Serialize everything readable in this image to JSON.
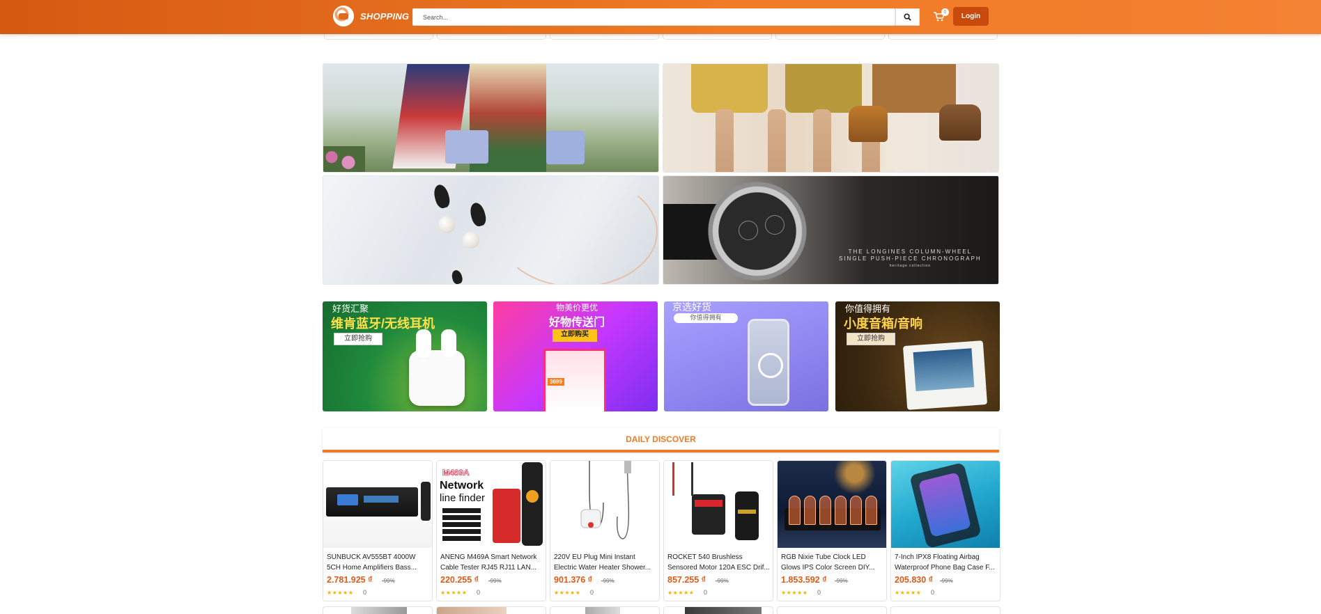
{
  "header": {
    "brand": "SHOPPING",
    "search_placeholder": "Search...",
    "cart_count": "0",
    "login_label": "Login",
    "accent_color": "#f07a25"
  },
  "banners": [
    {
      "name": "fashion-scarves-banner"
    },
    {
      "name": "leather-handbags-banner"
    },
    {
      "name": "swan-jewelry-banner"
    },
    {
      "name": "longines-watch-banner",
      "text_line1": "THE LONGINES COLUMN-WHEEL",
      "text_line2": "SINGLE PUSH-PIECE CHRONOGRAPH",
      "text_line3": "heritage collection"
    }
  ],
  "promos": [
    {
      "tag": "好货汇聚",
      "title": "维肯蓝牙/无线耳机",
      "button": "立即抢购"
    },
    {
      "tag": "物美价更优",
      "title": "好物传送门",
      "button": "立即购买",
      "price_tag": "3699"
    },
    {
      "tag": "京选好货",
      "title": "",
      "button": "你值得拥有"
    },
    {
      "tag": "你值得拥有",
      "title": "小度音箱/音响",
      "button": "立即抢购"
    }
  ],
  "discover_title": "DAILY DISCOVER",
  "products": [
    {
      "name_line1": "SUNBUCK AV555BT 4000W",
      "name_line2": "5CH Home Amplifiers Bass...",
      "price": "2.781.925 ₫",
      "discount": "-99%",
      "stars": "★★★★★",
      "sold": "0"
    },
    {
      "name_line1": "ANENG M469A Smart Network",
      "name_line2": "Cable Tester RJ45 RJ11 LAN...",
      "price": "220.255 ₫",
      "discount": "-99%",
      "stars": "★★★★★",
      "sold": "0",
      "img_text1": "M469A",
      "img_text2": "Network",
      "img_text3": "line finder"
    },
    {
      "name_line1": "220V EU Plug Mini Instant",
      "name_line2": "Electric Water Heater Shower...",
      "price": "901.376 ₫",
      "discount": "-99%",
      "stars": "★★★★★",
      "sold": "0"
    },
    {
      "name_line1": "ROCKET 540 Brushless",
      "name_line2": "Sensored Motor 120A ESC Drif...",
      "price": "857.255 ₫",
      "discount": "-99%",
      "stars": "★★★★★",
      "sold": "0"
    },
    {
      "name_line1": "RGB Nixie Tube Clock LED",
      "name_line2": "Glows IPS Color Screen DIY...",
      "price": "1.853.592 ₫",
      "discount": "-99%",
      "stars": "★★★★★",
      "sold": "0"
    },
    {
      "name_line1": "7-Inch IPX8 Floating Airbag",
      "name_line2": "Waterproof Phone Bag Case F...",
      "price": "205.830 ₫",
      "discount": "-99%",
      "stars": "★★★★★",
      "sold": "0"
    }
  ]
}
